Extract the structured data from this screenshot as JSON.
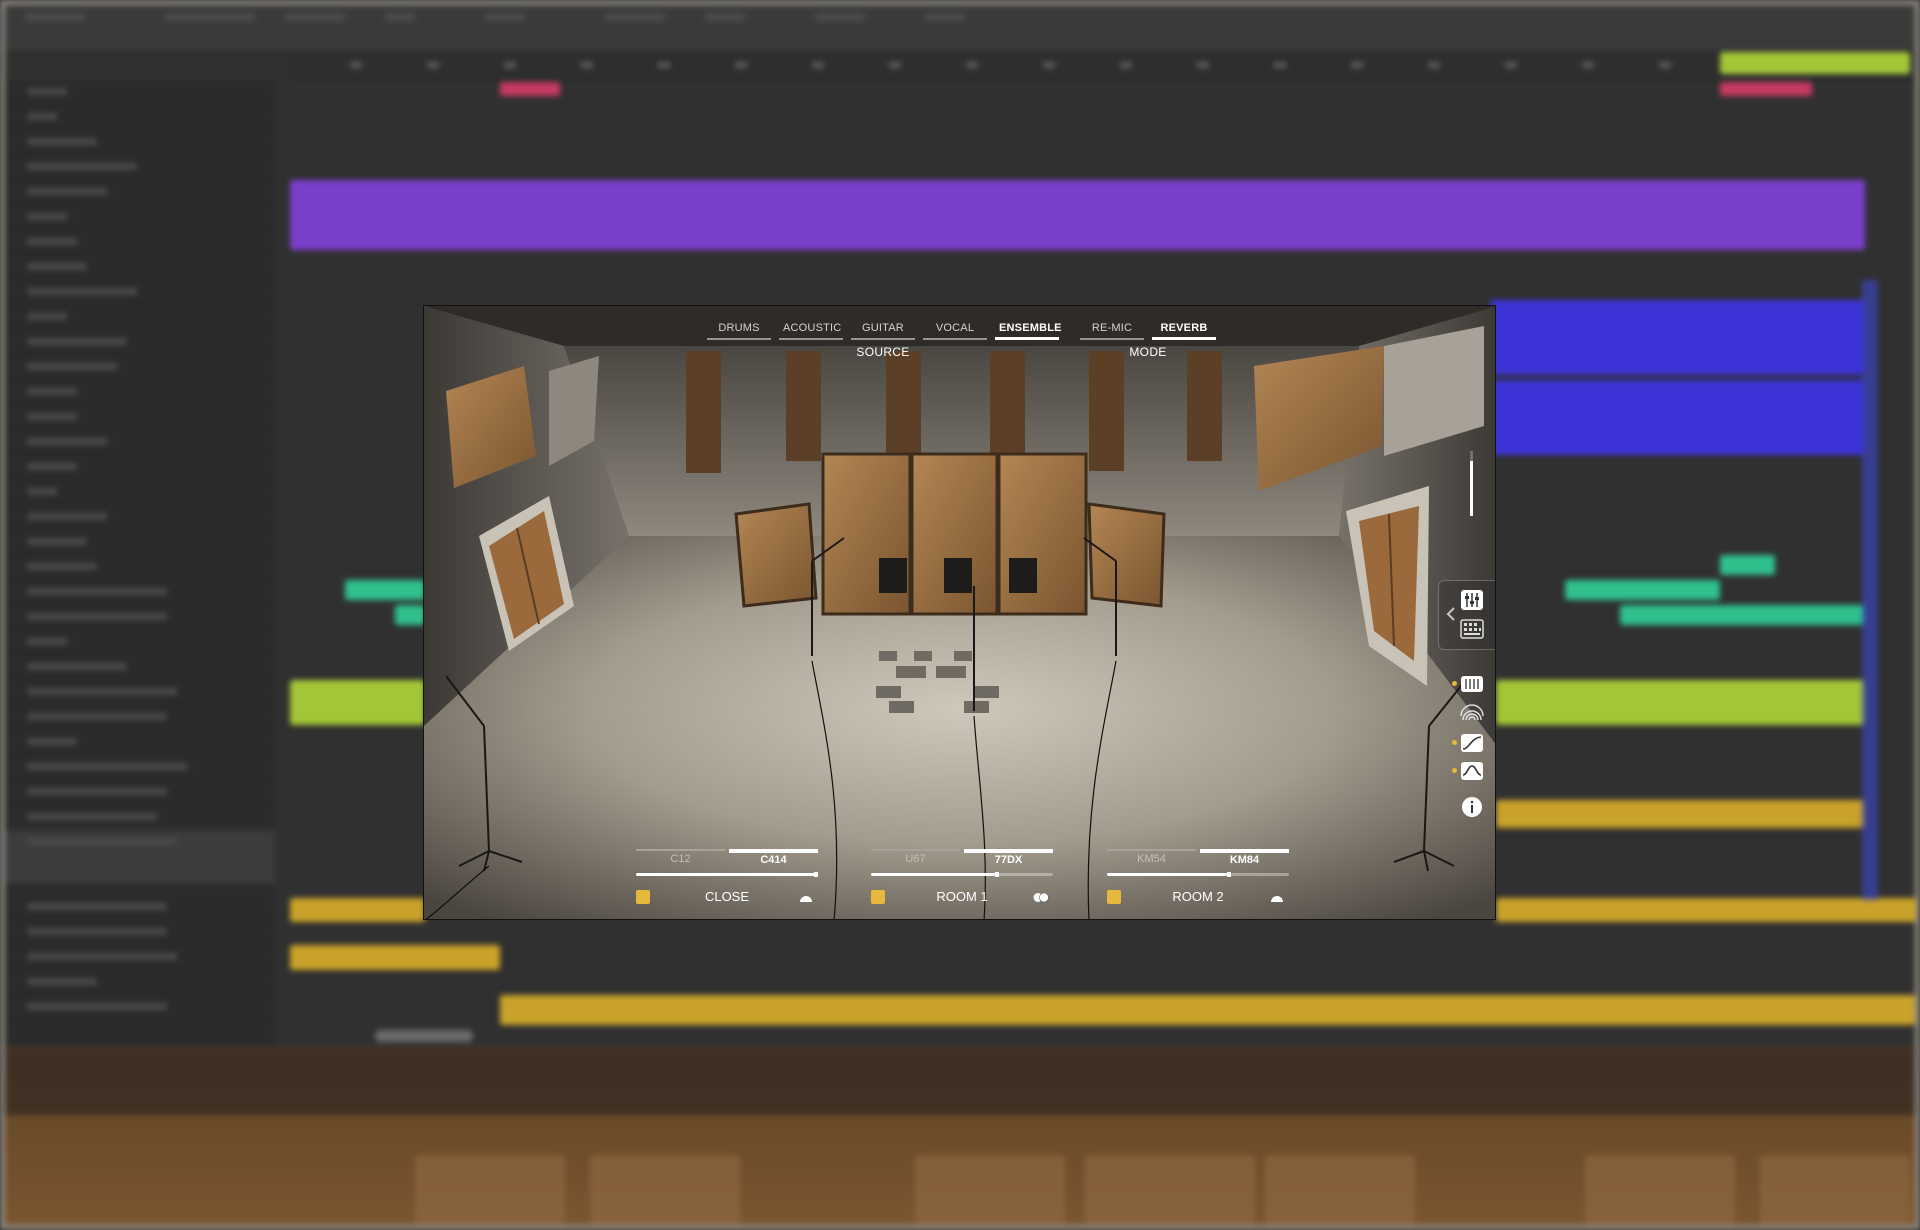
{
  "plugin": {
    "source_tabs": [
      "DRUMS",
      "ACOUSTIC",
      "GUITAR",
      "VOCAL",
      "ENSEMBLE"
    ],
    "source_active": "ENSEMBLE",
    "source_label": "SOURCE",
    "mode_tabs": [
      "RE-MIC",
      "REVERB"
    ],
    "mode_active": "REVERB",
    "mode_label": "MODE",
    "channels": [
      {
        "name": "CLOSE",
        "mics": [
          "C12",
          "C414"
        ],
        "active_mic": "C414",
        "level": 1.0,
        "pan_icon": "mono-pan-icon"
      },
      {
        "name": "ROOM 1",
        "mics": [
          "U67",
          "77DX"
        ],
        "active_mic": "77DX",
        "level": 0.68,
        "pan_icon": "stereo-pan-icon"
      },
      {
        "name": "ROOM 2",
        "mics": [
          "KM54",
          "KM84"
        ],
        "active_mic": "KM84",
        "level": 0.66,
        "pan_icon": "mono-pan-icon"
      }
    ],
    "output_level": 0.85,
    "side_icons": [
      "collapse-chevron-icon",
      "mixer-icon",
      "keyboard-grid-icon",
      "eq-rack-icon",
      "reverb-arcs-icon",
      "curve-icon",
      "filter-icon",
      "info-icon"
    ],
    "accent_color": "#e6b83c"
  }
}
